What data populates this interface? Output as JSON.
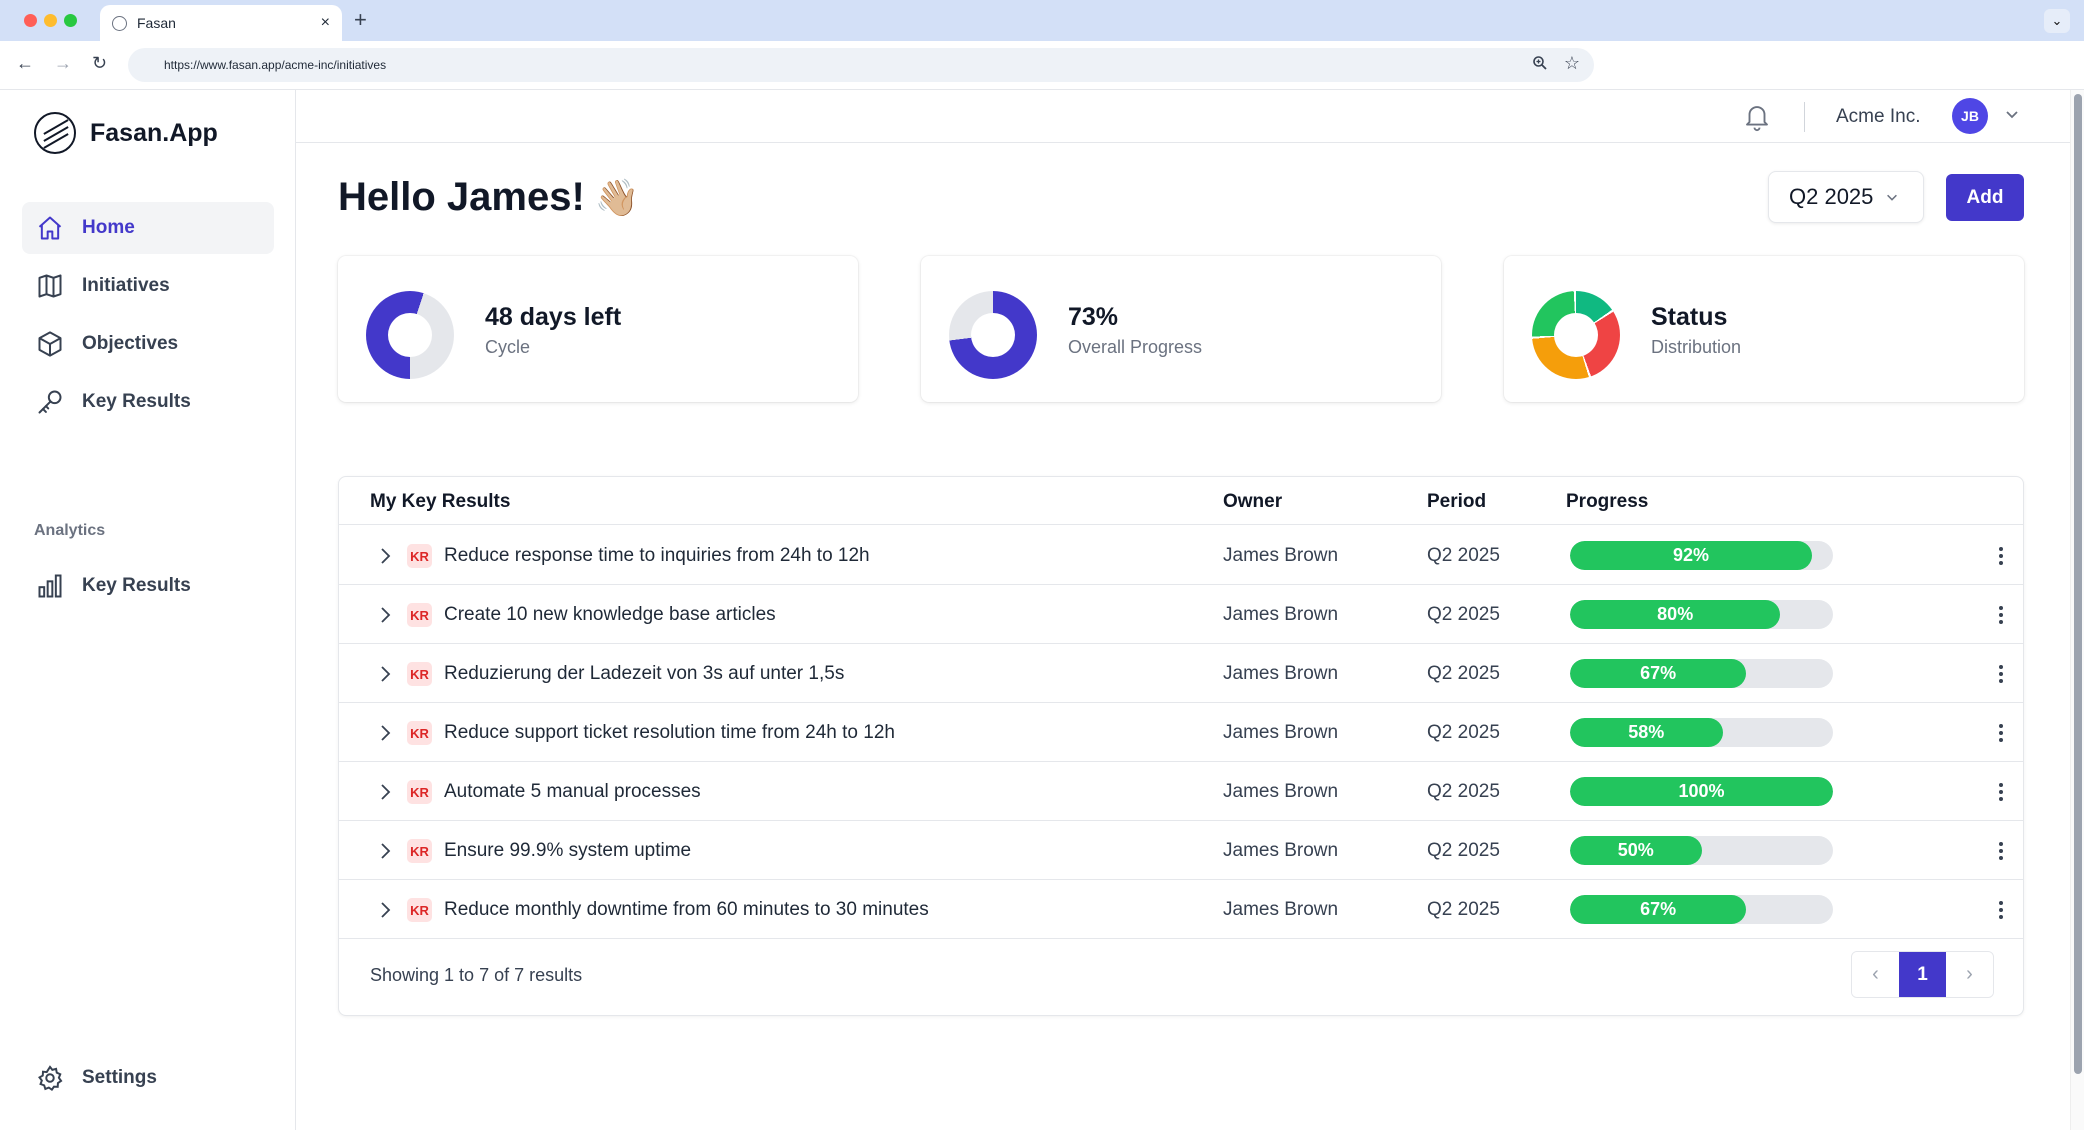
{
  "browser": {
    "tab_title": "Fasan",
    "tab_close": "×",
    "new_tab": "+",
    "url": "https://www.fasan.app/acme-inc/initiatives"
  },
  "sidebar": {
    "logo_text": "Fasan.App",
    "items": [
      {
        "label": "Home",
        "icon": "home-icon",
        "active": true
      },
      {
        "label": "Initiatives",
        "icon": "map-icon",
        "active": false
      },
      {
        "label": "Objectives",
        "icon": "cube-icon",
        "active": false
      },
      {
        "label": "Key Results",
        "icon": "key-icon",
        "active": false
      }
    ],
    "analytics_label": "Analytics",
    "analytics_items": [
      {
        "label": "Key Results",
        "icon": "bar-chart-icon"
      }
    ],
    "settings_label": "Settings"
  },
  "topbar": {
    "org_name": "Acme Inc.",
    "avatar_initials": "JB"
  },
  "header": {
    "greeting": "Hello James!",
    "greeting_emoji": "👋🏼",
    "period": "Q2 2025",
    "add_label": "Add"
  },
  "cards": [
    {
      "title": "48 days left",
      "subtitle": "Cycle",
      "ring_fraction": 0.55
    },
    {
      "title": "73%",
      "subtitle": "Overall Progress",
      "ring_fraction": 0.73
    },
    {
      "title": "Status",
      "subtitle": "Distribution"
    }
  ],
  "colors": {
    "accent": "#4338ca",
    "ring_track": "#e5e7eb",
    "status_green": "#22c55e",
    "status_red": "#ef4444",
    "status_orange": "#f59e0b",
    "status_teal": "#10b981"
  },
  "table": {
    "headers": {
      "title": "My Key Results",
      "owner": "Owner",
      "period": "Period",
      "progress": "Progress"
    },
    "badge": "KR",
    "rows": [
      {
        "name": "Reduce response time to inquiries from 24h to 12h",
        "owner": "James Brown",
        "period": "Q2 2025",
        "progress": 92,
        "progress_label": "92%"
      },
      {
        "name": "Create 10 new knowledge base articles",
        "owner": "James Brown",
        "period": "Q2 2025",
        "progress": 80,
        "progress_label": "80%"
      },
      {
        "name": "Reduzierung der Ladezeit von 3s auf unter 1,5s",
        "owner": "James Brown",
        "period": "Q2 2025",
        "progress": 67,
        "progress_label": "67%"
      },
      {
        "name": "Reduce support ticket resolution time from 24h to 12h",
        "owner": "James Brown",
        "period": "Q2 2025",
        "progress": 58,
        "progress_label": "58%"
      },
      {
        "name": "Automate 5 manual processes",
        "owner": "James Brown",
        "period": "Q2 2025",
        "progress": 100,
        "progress_label": "100%"
      },
      {
        "name": "Ensure 99.9% system uptime",
        "owner": "James Brown",
        "period": "Q2 2025",
        "progress": 50,
        "progress_label": "50%"
      },
      {
        "name": "Reduce monthly downtime from 60 minutes to 30 minutes",
        "owner": "James Brown",
        "period": "Q2 2025",
        "progress": 67,
        "progress_label": "67%"
      }
    ],
    "results_text": "Showing 1 to 7 of 7 results",
    "current_page": "1",
    "prev": "‹",
    "next": "›"
  }
}
